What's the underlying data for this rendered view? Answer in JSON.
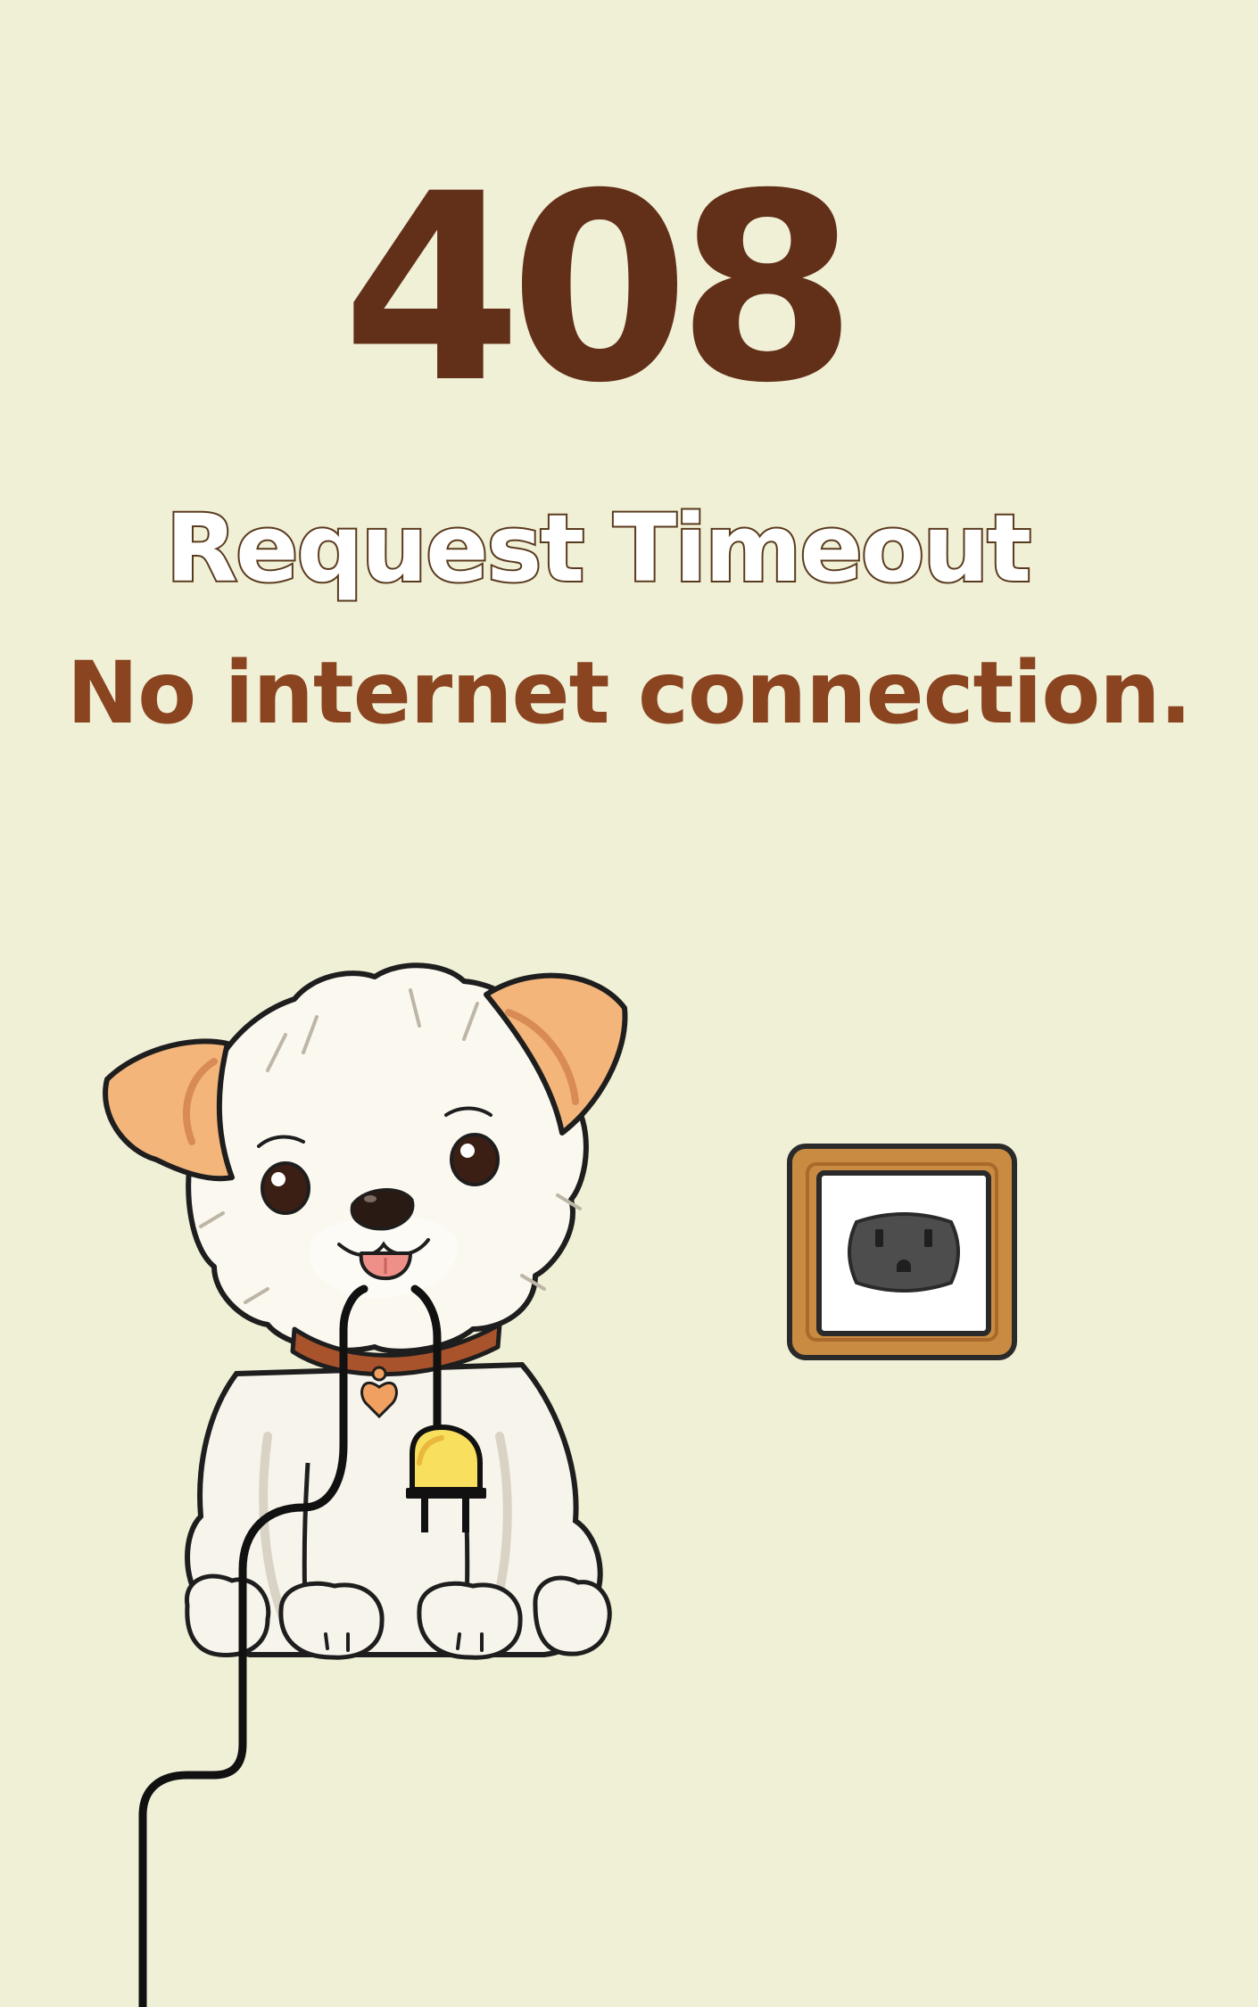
{
  "error": {
    "code": "408",
    "title": "Request Timeout",
    "message": "No internet connection."
  },
  "illustration": {
    "subject": "puppy-holding-unplugged-cable",
    "icons": [
      "puppy-icon",
      "plug-icon",
      "wall-outlet-icon",
      "cable-icon"
    ]
  },
  "colors": {
    "background": "#f0f0d7",
    "code": "#622f19",
    "message": "#8a4420",
    "title_outline": "#5a3a1d",
    "outlet_frame": "#c98b42"
  }
}
